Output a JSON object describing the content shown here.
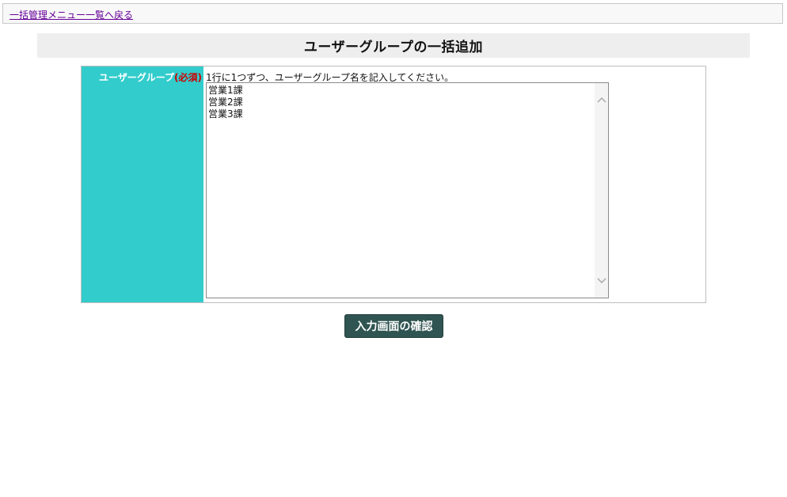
{
  "nav": {
    "back_link": "一括管理メニュー一覧へ戻る"
  },
  "page": {
    "title": "ユーザーグループの一括追加"
  },
  "form": {
    "field_label": "ユーザーグループ",
    "required_mark": "(必須)",
    "hint": "1行に1つずつ、ユーザーグループ名を記入してください。",
    "textarea_lines": [
      "営業1課",
      "営業2課",
      "営業3課"
    ]
  },
  "actions": {
    "confirm_label": "入力画面の確認"
  },
  "colors": {
    "label_bg": "#33cccc",
    "required": "#cc0000",
    "button_bg": "#2f5451",
    "link": "#660099"
  },
  "icons": {
    "scroll_up": "chevron-up-icon",
    "scroll_down": "chevron-down-icon"
  }
}
